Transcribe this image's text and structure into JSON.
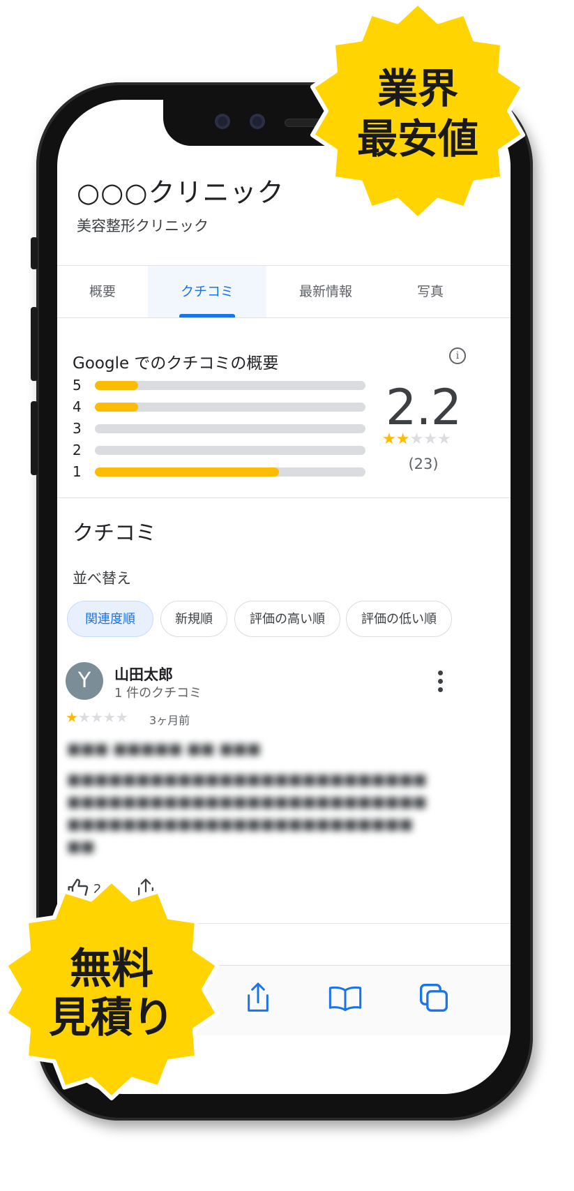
{
  "clinic": {
    "name": "○○○クリニック",
    "category": "美容整形クリニック"
  },
  "tabs": [
    {
      "label": "概要"
    },
    {
      "label": "クチコミ",
      "active": true
    },
    {
      "label": "最新情報"
    },
    {
      "label": "写真"
    }
  ],
  "summary": {
    "title": "Google でのクチコミの概要",
    "rating": "2.2",
    "rating_value": 2.2,
    "count": "(23)",
    "distribution": [
      {
        "star": "5",
        "fraction": 0.16
      },
      {
        "star": "4",
        "fraction": 0.16
      },
      {
        "star": "3",
        "fraction": 0.0
      },
      {
        "star": "2",
        "fraction": 0.0
      },
      {
        "star": "1",
        "fraction": 0.68
      }
    ]
  },
  "reviews": {
    "title": "クチコミ",
    "sort_label": "並べ替え",
    "sort_options": [
      "関連度順",
      "新規順",
      "評価の高い順",
      "評価の低い順"
    ],
    "selected_sort": "関連度順"
  },
  "review": {
    "avatar_letter": "Y",
    "author": "山田太郎",
    "author_sub": "1 件のクチコミ",
    "stars": 1,
    "date": "3ヶ月前",
    "likes": "2"
  },
  "toolbar_icons": [
    "share-icon",
    "bookmarks-icon",
    "tabs-icon"
  ],
  "badges": {
    "top_line1": "業界",
    "top_line2": "最安値",
    "bottom_line1": "無料",
    "bottom_line2": "見積り"
  },
  "colors": {
    "accent": "#1a73e8",
    "star": "#fbbc04",
    "badge": "#ffd400"
  }
}
